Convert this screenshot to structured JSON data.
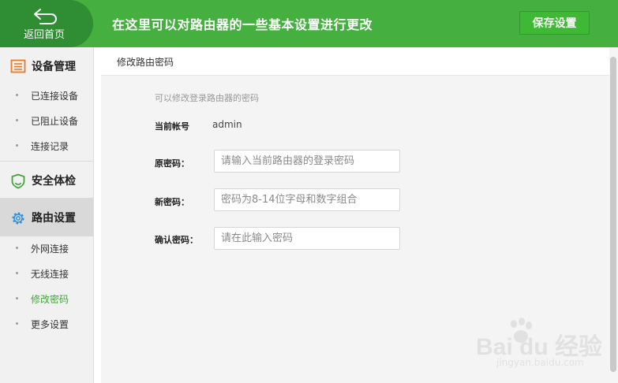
{
  "header": {
    "home_label": "返回首页",
    "banner_title": "在这里可以对路由器的一些基本设置进行更改",
    "save_label": "保存设置"
  },
  "sidebar": {
    "sections": [
      {
        "title": "设备管理",
        "icon": "list-icon",
        "items": [
          "已连接设备",
          "已阻止设备",
          "连接记录"
        ]
      },
      {
        "title": "安全体检",
        "icon": "shield-icon",
        "items": []
      },
      {
        "title": "路由设置",
        "icon": "gear-icon",
        "active": true,
        "items": [
          "外网连接",
          "无线连接",
          "修改密码",
          "更多设置"
        ],
        "active_item": "修改密码"
      }
    ]
  },
  "main": {
    "panel_title": "修改路由密码",
    "hint": "可以修改登录路由器的密码",
    "account_label": "当前帐号",
    "account_value": "admin",
    "old_label": "原密码：",
    "old_placeholder": "请输入当前路由器的登录密码",
    "new_label": "新密码：",
    "new_placeholder": "密码为8-14位字母和数字组合",
    "confirm_label": "确认密码：",
    "confirm_placeholder": "请在此输入密码"
  },
  "watermark": {
    "main": "Bai du 经验",
    "sub": "jingyan.baidu.com"
  },
  "colors": {
    "brand_green": "#45b03f",
    "home_green": "#2f8d33",
    "active_link": "#3fa637"
  }
}
